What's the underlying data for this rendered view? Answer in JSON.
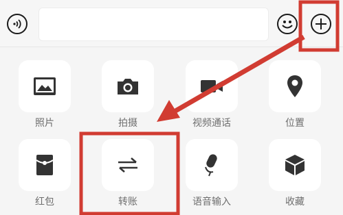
{
  "toolbar": {
    "voice_icon": "voice-icon",
    "input_placeholder": "",
    "emoji_icon": "emoji-icon",
    "plus_icon": "plus-icon"
  },
  "grid": {
    "items": [
      {
        "label": "照片",
        "icon": "photo-icon"
      },
      {
        "label": "拍摄",
        "icon": "camera-icon"
      },
      {
        "label": "视频通话",
        "icon": "video-call-icon"
      },
      {
        "label": "位置",
        "icon": "location-icon"
      },
      {
        "label": "红包",
        "icon": "red-packet-icon"
      },
      {
        "label": "转账",
        "icon": "transfer-icon"
      },
      {
        "label": "语音输入",
        "icon": "microphone-icon"
      },
      {
        "label": "收藏",
        "icon": "favorites-icon"
      }
    ]
  },
  "annotations": {
    "highlight_color": "#d13c32"
  }
}
